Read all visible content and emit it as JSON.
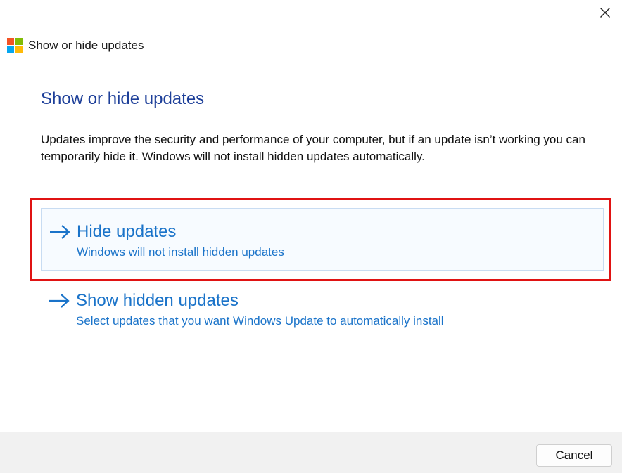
{
  "window": {
    "title": "Show or hide updates",
    "logo_colors": [
      "#f35325",
      "#81bc06",
      "#05a6f0",
      "#ffba08"
    ]
  },
  "main": {
    "heading": "Show or hide updates",
    "description": "Updates improve the security and performance of your computer, but if an update isn’t working you can temporarily hide it. Windows will not install hidden updates automatically.",
    "options": [
      {
        "title": "Hide updates",
        "subtitle": "Windows will not install hidden updates",
        "icon": "arrow-right-icon",
        "selected": true
      },
      {
        "title": "Show hidden updates",
        "subtitle": "Select updates that you want Windows Update to automatically install",
        "icon": "arrow-right-icon",
        "selected": false
      }
    ]
  },
  "footer": {
    "cancel_label": "Cancel"
  },
  "colors": {
    "heading": "#1d3f99",
    "link": "#1a73c9",
    "highlight": "#e01313"
  }
}
